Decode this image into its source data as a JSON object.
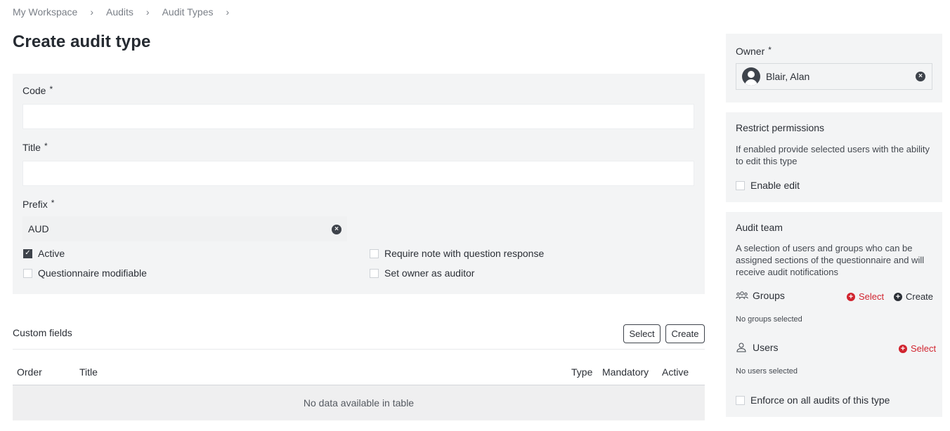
{
  "breadcrumb": [
    "My Workspace",
    "Audits",
    "Audit Types"
  ],
  "page_title": "Create audit type",
  "form": {
    "code_label": "Code",
    "title_label": "Title",
    "prefix_label": "Prefix",
    "required_mark": "*",
    "code_value": "",
    "title_value": "",
    "prefix_value": "AUD",
    "checkboxes": {
      "active": {
        "label": "Active",
        "checked": true
      },
      "questionnaire_modifiable": {
        "label": "Questionnaire modifiable",
        "checked": false
      },
      "require_note": {
        "label": "Require note with question response",
        "checked": false
      },
      "set_owner_auditor": {
        "label": "Set owner as auditor",
        "checked": false
      }
    }
  },
  "custom_fields": {
    "title": "Custom fields",
    "select_label": "Select",
    "create_label": "Create",
    "columns": [
      "Order",
      "Title",
      "Type",
      "Mandatory",
      "Active"
    ],
    "empty_text": "No data available in table"
  },
  "owner": {
    "label": "Owner",
    "value": "Blair, Alan"
  },
  "restrict": {
    "title": "Restrict permissions",
    "description": "If enabled provide selected users with the ability to edit this type",
    "enable_label": "Enable edit"
  },
  "audit_team": {
    "title": "Audit team",
    "description": "A selection of users and groups who can be assigned sections of the questionnaire and will receive audit notifications",
    "groups_label": "Groups",
    "groups_select": "Select",
    "groups_create": "Create",
    "groups_empty": "No groups selected",
    "users_label": "Users",
    "users_select": "Select",
    "users_empty": "No users selected",
    "enforce_label": "Enforce on all audits of this type"
  },
  "colors": {
    "panel_bg": "#f3f4f5",
    "accent_red": "#d1242f",
    "dark": "#3e434b"
  }
}
